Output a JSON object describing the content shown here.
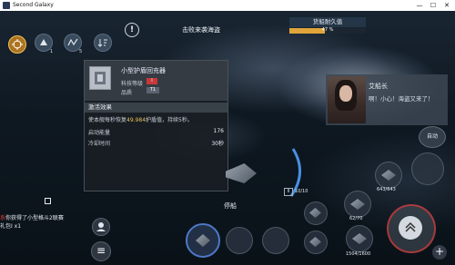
{
  "window": {
    "title": "Second Galaxy",
    "minimize": "—",
    "maximize": "☐",
    "close": "✕"
  },
  "top": {
    "alert_icon_text": "!",
    "banner": "击败来袭海盗",
    "buttons": [
      {
        "name": "target-lock",
        "badge": ""
      },
      {
        "name": "fleet",
        "badge": "1"
      },
      {
        "name": "route",
        "badge": "5"
      },
      {
        "name": "sort",
        "badge": ""
      }
    ]
  },
  "durability": {
    "label": "货船耐久值",
    "value_text": "47 %",
    "percent": 47,
    "fill_color": "#e0a53a"
  },
  "module_panel": {
    "name": "小型护盾回充器",
    "tech_label": "科技等级",
    "tech_value": "I",
    "quality_label": "品质",
    "quality_value": "T1",
    "section_title": "激活效果",
    "desc_prefix": "使本舰每秒恢复",
    "desc_highlight": "49.984",
    "desc_suffix": "护盾值，持续5秒。",
    "stats": [
      {
        "label": "启动能量",
        "value": "176"
      },
      {
        "label": "冷却时间",
        "value": "30秒"
      }
    ]
  },
  "crew": {
    "name": "艾船长",
    "message": "啊！小心！海盗又来了！"
  },
  "auto_button": "自动",
  "chat": {
    "channel": "系",
    "text1": "你获得了小型格斗2联赛",
    "text2": "礼包Ⅰ x1"
  },
  "dock_label": "停船",
  "speed": {
    "pause": "II",
    "value": "10/10"
  },
  "skills": [
    {
      "label": "643/643"
    },
    {
      "label": "62/70"
    },
    {
      "label": "1504/1600"
    }
  ],
  "plus": "+",
  "menu_icon": "≡"
}
